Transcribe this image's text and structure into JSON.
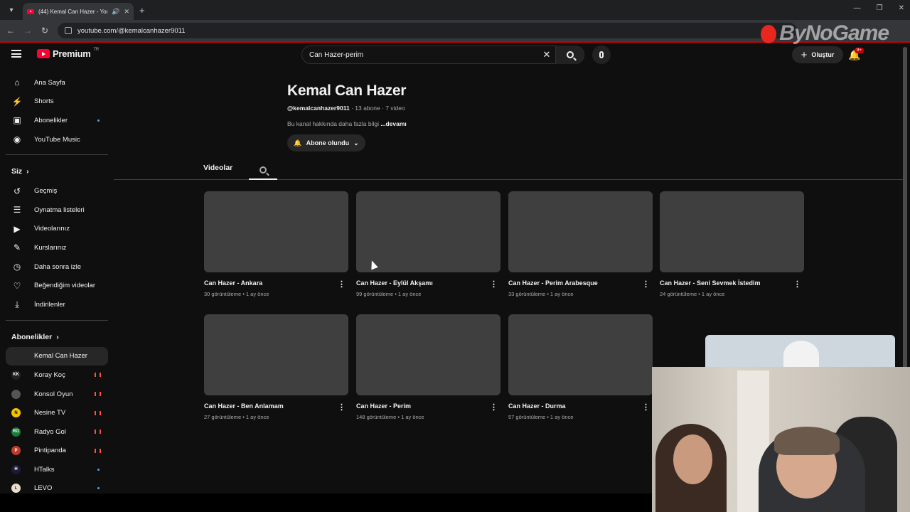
{
  "browser": {
    "tab_title": "(44) Kemal Can Hazer - You",
    "url": "youtube.com/@kemalcanhazer9011"
  },
  "watermark": "ByNoGame",
  "masthead": {
    "logo_text": "Premium",
    "logo_region": "TR",
    "search_value": "Can Hazer-perim",
    "create_label": "Oluştur",
    "notification_badge": "9+"
  },
  "sidebar": {
    "main": [
      {
        "label": "Ana Sayfa",
        "icon": "home-icon"
      },
      {
        "label": "Shorts",
        "icon": "shorts-icon"
      },
      {
        "label": "Abonelikler",
        "icon": "subscriptions-icon"
      },
      {
        "label": "YouTube Music",
        "icon": "music-icon"
      }
    ],
    "you_header": "Siz",
    "you": [
      {
        "label": "Geçmiş",
        "icon": "history-icon"
      },
      {
        "label": "Oynatma listeleri",
        "icon": "playlists-icon"
      },
      {
        "label": "Videolarınız",
        "icon": "your-videos-icon"
      },
      {
        "label": "Kurslarınız",
        "icon": "courses-icon"
      },
      {
        "label": "Daha sonra izle",
        "icon": "watch-later-icon"
      },
      {
        "label": "Beğendiğim videolar",
        "icon": "liked-icon"
      },
      {
        "label": "İndirilenler",
        "icon": "downloads-icon"
      }
    ],
    "subs_header": "Abonelikler",
    "subs": [
      {
        "label": "Kemal Can Hazer",
        "status": "active"
      },
      {
        "label": "Koray Koç",
        "status": "live",
        "avatar_color": "#222222",
        "avatar_text": "KK"
      },
      {
        "label": "Konsol Oyun",
        "status": "live",
        "avatar_color": "#555555",
        "avatar_text": ""
      },
      {
        "label": "Nesine TV",
        "status": "live",
        "avatar_color": "#f5c400",
        "avatar_text": "N"
      },
      {
        "label": "Radyo Gol",
        "status": "live",
        "avatar_color": "#1a7a3a",
        "avatar_text": "RG"
      },
      {
        "label": "Pintipanda",
        "status": "live",
        "avatar_color": "#c0392b",
        "avatar_text": "P"
      },
      {
        "label": "HTalks",
        "status": "new",
        "avatar_color": "#1b1b3a",
        "avatar_text": "H"
      },
      {
        "label": "LEVO",
        "status": "new",
        "avatar_color": "#e8e0c8",
        "avatar_text": "L"
      }
    ]
  },
  "channel": {
    "name": "Kemal Can Hazer",
    "handle": "@kemalcanhazer9011",
    "stats": "· 13 abone · 7 video",
    "desc": "Bu kanal hakkında daha fazla bilgi",
    "desc_more": "...devamı",
    "subscribe_label": "Abone olundu"
  },
  "tabs": {
    "videos": "Videolar"
  },
  "videos": [
    {
      "title": "Can Hazer - Ankara",
      "meta": "30 görüntüleme • 1 ay önce"
    },
    {
      "title": "Can Hazer - Eylül Akşamı",
      "meta": "99 görüntüleme • 1 ay önce"
    },
    {
      "title": "Can Hazer - Perim Arabesque",
      "meta": "33 görüntüleme • 1 ay önce"
    },
    {
      "title": "Can Hazer - Seni Sevmek İstedim",
      "meta": "24 görüntüleme • 1 ay önce"
    },
    {
      "title": "Can Hazer - Ben Anlamam",
      "meta": "27 görüntüleme • 1 ay önce"
    },
    {
      "title": "Can Hazer - Perim",
      "meta": "148 görüntüleme • 1 ay önce"
    },
    {
      "title": "Can Hazer - Durma",
      "meta": "57 görüntüleme • 1 ay önce"
    }
  ]
}
